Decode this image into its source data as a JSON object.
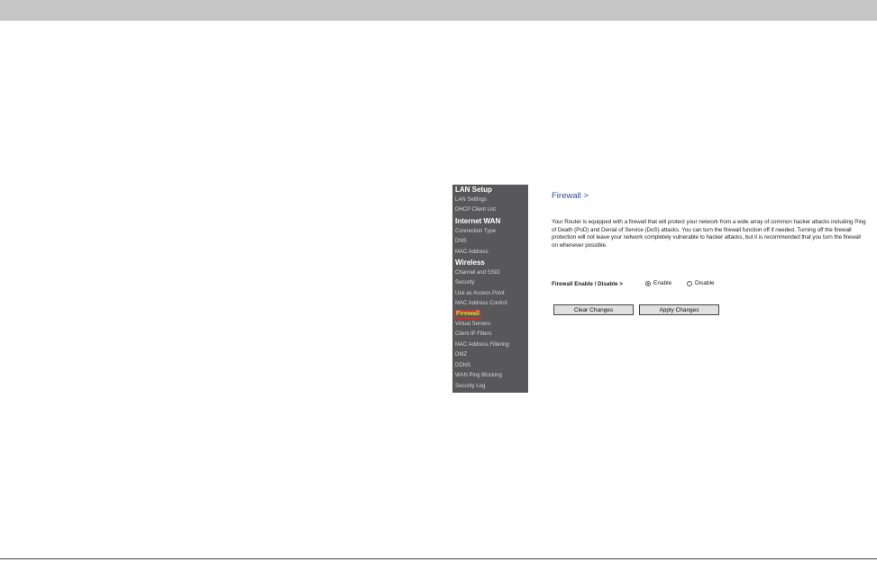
{
  "sidebar": {
    "sections": [
      {
        "title": "LAN Setup",
        "items": [
          "LAN Settings",
          "DHCP Client List"
        ]
      },
      {
        "title": "Internet WAN",
        "items": [
          "Connection Type",
          "DNS",
          "MAC Address"
        ]
      },
      {
        "title": "Wireless",
        "items": [
          "Channel and SSID",
          "Security",
          "Use as Access Point",
          "MAC Address Control"
        ]
      }
    ],
    "firewall_items": [
      "Firewall",
      "Virtual Servers",
      "Client IP Filters",
      "MAC Address Filtering",
      "DMZ",
      "DDNS",
      "WAN Ping Blocking",
      "Security Log"
    ]
  },
  "main": {
    "title": "Firewall >",
    "description": "Your Router is equipped with a firewall that will protect your network from a wide array of common hacker attacks including Ping of Death (PoD) and Denial of Service (DoS) attacks. You can turn the firewall function off if needed. Turning off the firewall protection will not leave your network completely vulnerable to hacker attacks, but it is recommended that you turn the firewall on whenever possible.",
    "toggle_label": "Firewall Enable / Disable >",
    "options": {
      "enable": "Enable",
      "disable": "Disable",
      "selected": "Enable"
    },
    "buttons": {
      "clear": "Clear Changes",
      "apply": "Apply Changes"
    }
  }
}
